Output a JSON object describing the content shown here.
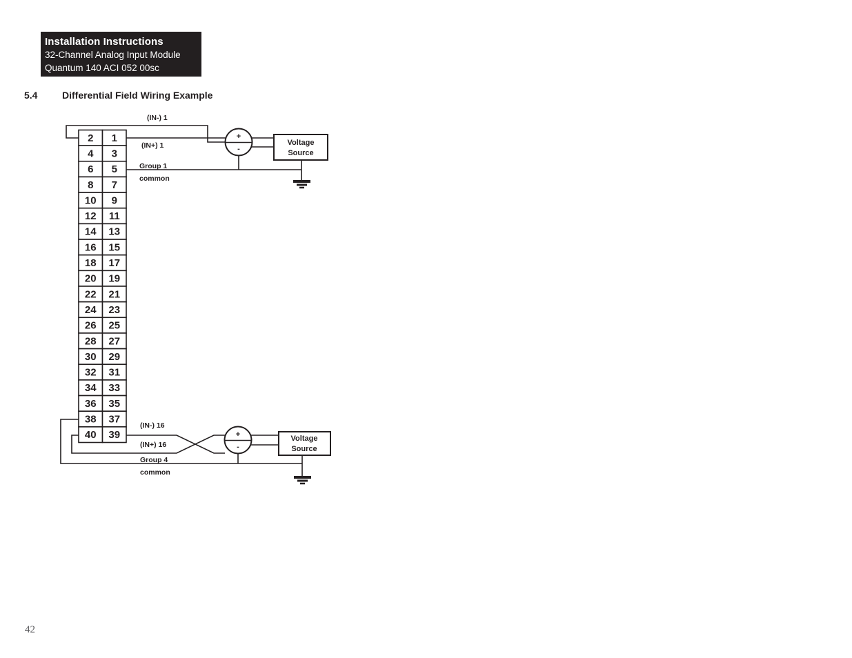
{
  "header": {
    "title": "Installation Instructions",
    "subtitle": "32-Channel Analog Input Module",
    "model": "Quantum 140 ACI 052 00sc",
    "background_color": "#231f20",
    "text_color": "#ffffff"
  },
  "section": {
    "number": "5.4",
    "title": "Differential Field Wiring Example"
  },
  "page_number": "42",
  "terminal_block": {
    "rows": [
      {
        "left": "2",
        "right": "1"
      },
      {
        "left": "4",
        "right": "3"
      },
      {
        "left": "6",
        "right": "5"
      },
      {
        "left": "8",
        "right": "7"
      },
      {
        "left": "10",
        "right": "9"
      },
      {
        "left": "12",
        "right": "11"
      },
      {
        "left": "14",
        "right": "13"
      },
      {
        "left": "16",
        "right": "15"
      },
      {
        "left": "18",
        "right": "17"
      },
      {
        "left": "20",
        "right": "19"
      },
      {
        "left": "22",
        "right": "21"
      },
      {
        "left": "24",
        "right": "23"
      },
      {
        "left": "26",
        "right": "25"
      },
      {
        "left": "28",
        "right": "27"
      },
      {
        "left": "30",
        "right": "29"
      },
      {
        "left": "32",
        "right": "31"
      },
      {
        "left": "34",
        "right": "33"
      },
      {
        "left": "36",
        "right": "35"
      },
      {
        "left": "38",
        "right": "37"
      },
      {
        "left": "40",
        "right": "39"
      }
    ]
  },
  "diagram": {
    "top_group": {
      "in_minus_label": "(IN-) 1",
      "in_plus_label": "(IN+) 1",
      "common_label_line1": "Group 1",
      "common_label_line2": "common",
      "source_label_line1": "Voltage",
      "source_label_line2": "Source",
      "polarity_plus": "+",
      "polarity_minus": "-"
    },
    "bottom_group": {
      "in_minus_label": "(IN-) 16",
      "in_plus_label": "(IN+) 16",
      "common_label_line1": "Group 4",
      "common_label_line2": "common",
      "source_label_line1": "Voltage",
      "source_label_line2": "Source",
      "polarity_plus": "+",
      "polarity_minus": "-"
    }
  },
  "colors": {
    "ink": "#231f20",
    "paper": "#ffffff",
    "page_number": "#58585b"
  }
}
